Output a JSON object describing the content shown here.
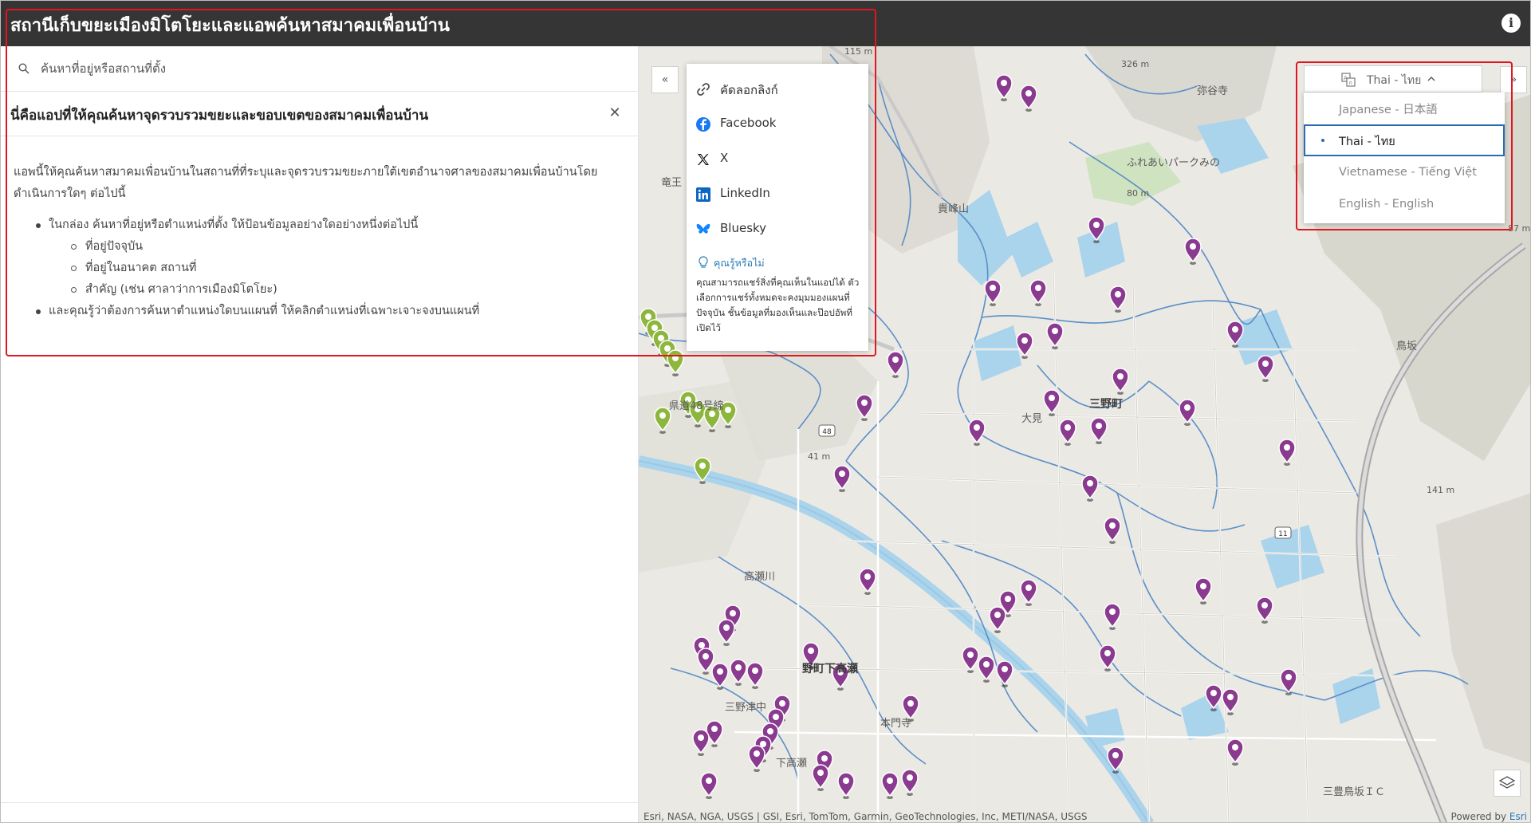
{
  "app": {
    "title": "สถานีเก็บขยะเมืองมิโตโยะและแอพค้นหาสมาคมเพื่อนบ้าน",
    "info_icon": "info-icon"
  },
  "search": {
    "placeholder": "ค้นหาที่อยู่หรือสถานที่ตั้ง"
  },
  "about": {
    "title": "นี่คือแอปที่ให้คุณค้นหาจุดรวบรวมขยะและขอบเขตของสมาคมเพื่อนบ้าน",
    "intro": "แอพนี้ให้คุณค้นหาสมาคมเพื่อนบ้านในสถานที่ที่ระบุและจุดรวบรวมขยะภายใต้เขตอำนาจศาลของสมาคมเพื่อนบ้านโดยดำเนินการใดๆ ต่อไปนี้",
    "bullet1": "ในกล่อง ค้นหาที่อยู่หรือตำแหน่งที่ตั้ง ให้ป้อนข้อมูลอย่างใดอย่างหนึ่งต่อไปนี้",
    "sub1": "ที่อยู่ปัจจุบัน",
    "sub2": "ที่อยู่ในอนาคต สถานที่",
    "sub3": "สำคัญ (เช่น ศาลาว่าการเมืองมิโตโยะ)",
    "bullet2": "และคุณรู้ว่าต้องการค้นหาตำแหน่งใดบนแผนที่ ให้คลิกตำแหน่งที่เฉพาะเจาะจงบนแผนที่"
  },
  "share": {
    "items": [
      {
        "label": "คัดลอกลิงก์",
        "icon": "link-icon"
      },
      {
        "label": "Facebook",
        "icon": "facebook-icon"
      },
      {
        "label": "X",
        "icon": "x-icon"
      },
      {
        "label": "LinkedIn",
        "icon": "linkedin-icon"
      },
      {
        "label": "Bluesky",
        "icon": "bluesky-icon"
      }
    ],
    "tip_title": "คุณรู้หรือไม่",
    "tip_body": "คุณสามารถแชร์สิ่งที่คุณเห็นในแอปได้ ตัวเลือกการแชร์ทั้งหมดจะคงมุมมองแผนที่ปัจจุบัน ชั้นข้อมูลที่มองเห็นและป๊อปอัพที่เปิดไว้"
  },
  "language": {
    "current": "Thai - ไทย",
    "options": [
      {
        "label": "Japanese - 日本語",
        "selected": false
      },
      {
        "label": "Thai - ไทย",
        "selected": true
      },
      {
        "label": "Vietnamese - Tiếng Việt",
        "selected": false
      },
      {
        "label": "English - English",
        "selected": false
      }
    ]
  },
  "map": {
    "labels": {
      "l1": "三野町",
      "l2": "野町下高瀬",
      "l3": "本門寺",
      "l4": "下高瀬",
      "l5": "三野津中",
      "l6": "三豊鳥坂ＩＣ",
      "l7": "貴峰山",
      "l8": "ふれあいパークみの",
      "l9": "弥谷寺",
      "l10": "鳥坂",
      "l11": "高瀬川",
      "l12": "大見",
      "l13": "竜王",
      "l14": "県道48号線",
      "l15": "80 m",
      "l16": "141 m",
      "l17": "41 m",
      "l18": "115 m",
      "l19": "326 m",
      "l20": "87 m"
    },
    "attribution": "Esri, NASA, NGA, USGS | GSI, Esri, TomTom, Garmin, GeoTechnologies, Inc, METI/NASA, USGS",
    "powered_prefix": "Powered by ",
    "powered_brand": "Esri",
    "colors": {
      "purple_marker": "#8a3b8f",
      "green_marker": "#8db63c",
      "water": "#aad3ec",
      "road_blue": "#5b8fc7"
    }
  }
}
